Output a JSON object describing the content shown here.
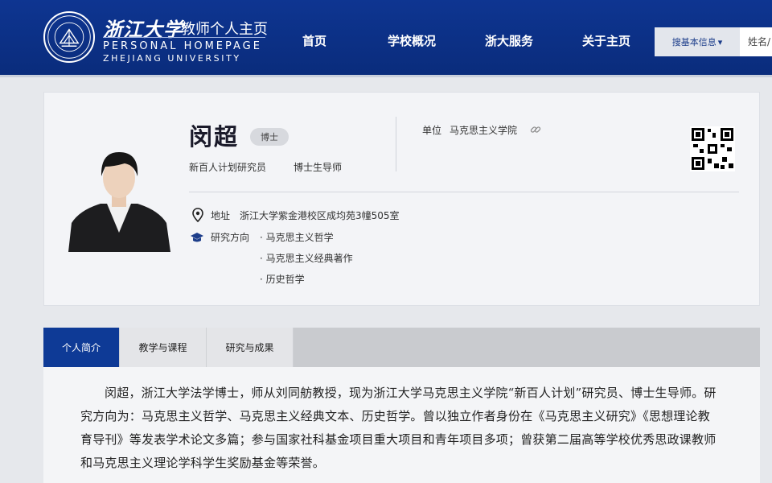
{
  "header": {
    "logo_cn": "浙江大学",
    "logo_subtitle": "教师个人主页",
    "logo_en_line1": "PERSONAL HOMEPAGE",
    "logo_en_line2": "ZHEJIANG UNIVERSITY",
    "logo_icon": "zju-seal-icon",
    "nav": [
      "首页",
      "学校概况",
      "浙大服务",
      "关于主页"
    ],
    "search_select_label": "搜基本信息",
    "search_placeholder": "姓名/",
    "colors": {
      "brand": "#0e3591",
      "accent": "#0e3a96"
    }
  },
  "profile": {
    "name": "闵超",
    "degree": "博士",
    "titles": [
      "新百人计划研究员",
      "博士生导师"
    ],
    "unit_label": "单位",
    "unit_value": "马克思主义学院",
    "address_label": "地址",
    "address_value": "浙江大学紫金港校区成均苑3幢505室",
    "research_label": "研究方向",
    "research_items": [
      "· 马克思主义哲学",
      "· 马克思主义经典著作",
      "· 历史哲学"
    ]
  },
  "tabs": [
    {
      "label": "个人简介",
      "active": true
    },
    {
      "label": "教学与课程",
      "active": false
    },
    {
      "label": "研究与成果",
      "active": false
    }
  ],
  "bio": {
    "text": "闵超，浙江大学法学博士，师从刘同舫教授，现为浙江大学马克思主义学院“新百人计划”研究员、博士生导师。研究方向为：马克思主义哲学、马克思主义经典文本、历史哲学。曾以独立作者身份在《马克思主义研究》《思想理论教育导刊》等发表学术论文多篇；参与国家社科基金项目重大项目和青年项目多项；曾获第二届高等学校优秀思政课教师和马克思主义理论学科学生奖励基金等荣誉。"
  }
}
